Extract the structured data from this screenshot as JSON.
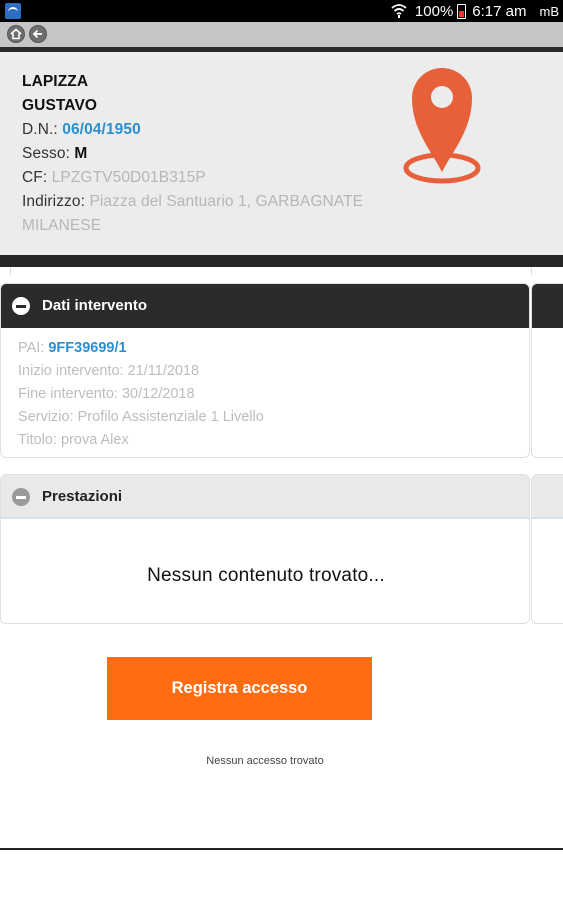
{
  "statusbar": {
    "battery_pct": "100%",
    "time": "6:17 am",
    "carrier": "mB"
  },
  "patient": {
    "surname": "LAPIZZA",
    "name": "GUSTAVO",
    "dob_label": "D.N.:",
    "dob": "06/04/1950",
    "sex_label": "Sesso:",
    "sex": "M",
    "cf_label": "CF:",
    "cf": "LPZGTV50D01B315P",
    "address_label": "Indirizzo:",
    "address_line1": "Piazza del Santuario 1, GARBAGNATE",
    "address_line2": "MILANESE",
    "pin_color": "#e8603a"
  },
  "dati_intervento": {
    "title": "Dati intervento",
    "pai_label": "PAI:",
    "pai": "9FF39699/1",
    "inizio_label": "Inizio intervento:",
    "inizio": "21/11/2018",
    "fine_label": "Fine intervento:",
    "fine": "30/12/2018",
    "servizio_label": "Servizio:",
    "servizio": "Profilo Assistenziale 1 Livello",
    "titolo_label": "Titolo:",
    "titolo": "prova Alex"
  },
  "prestazioni": {
    "title": "Prestazioni",
    "empty_text": "Nessun contenuto trovato..."
  },
  "actions": {
    "register_label": "Registra accesso",
    "accent": "#ff6d12",
    "no_access_text": "Nessun accesso trovato"
  }
}
